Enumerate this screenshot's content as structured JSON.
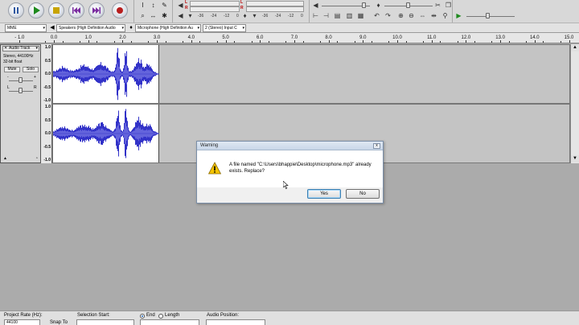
{
  "toolbar": {
    "meter_ticks_left": [
      "-36",
      "-24",
      "-12",
      "0"
    ],
    "meter_ticks_right": [
      "-36",
      "-24",
      "-12",
      "0"
    ],
    "meter_lr_top": "L",
    "meter_lr_bottom": "R"
  },
  "device_toolbar": {
    "host": "MME",
    "output_device": "Speakers (High Definition Audio",
    "input_device": "Microphone (High Definition Au",
    "input_channels": "2 (Stereo) Input C"
  },
  "ruler": {
    "labels": [
      "- 1.0",
      "0.0",
      "1.0",
      "2.0",
      "3.0",
      "4.0",
      "5.0",
      "6.0",
      "7.0",
      "8.0",
      "9.0",
      "10.0",
      "11.0",
      "12.0",
      "13.0",
      "14.0",
      "15.0"
    ]
  },
  "track": {
    "name": "Audio Track",
    "rate": "Stereo, 44100Hz",
    "format": "32-bit float",
    "mute_label": "Mute",
    "solo_label": "Solo",
    "gain_minus": "-",
    "gain_plus": "+",
    "pan_left": "L",
    "pan_right": "R",
    "scale_labels": [
      "1.0",
      "0.5",
      "0.0",
      "-0.5",
      "-1.0"
    ]
  },
  "dialog": {
    "title": "Warning",
    "close_glyph": "x",
    "message_line1": "A file named \"C:\\Users\\bhappie\\Desktop\\microphone.mp3\" already",
    "message_line2": "exists.  Replace?",
    "yes_label": "Yes",
    "no_label": "No"
  },
  "selection_bar": {
    "project_rate_label": "Project Rate (Hz):",
    "project_rate_value": "44100",
    "snap_label": "Snap To",
    "selection_start_label": "Selection Start:",
    "end_label": "End",
    "length_label": "Length",
    "audio_position_label": "Audio Position:"
  },
  "colors": {
    "waveform": "#3232c8",
    "waveform_rms": "#6464dc",
    "track_bg": "#c4c4c4"
  }
}
